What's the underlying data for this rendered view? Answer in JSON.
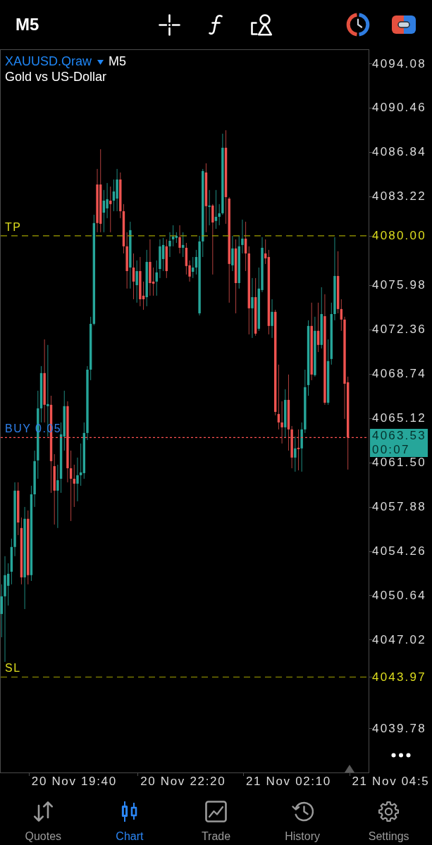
{
  "header": {
    "timeframe": "M5"
  },
  "chart": {
    "symbol": {
      "name": "XAUUSD.Qraw",
      "timeframe": "M5",
      "description": "Gold vs US-Dollar"
    },
    "current_price": {
      "price": "4063.53",
      "countdown": "00:07"
    },
    "chart_data": {
      "type": "candlestick",
      "categories": [
        null,
        null,
        null,
        null,
        null,
        null,
        null,
        null,
        null,
        null,
        null,
        null,
        null,
        null,
        null,
        null,
        null,
        null,
        null,
        null,
        null,
        null,
        "20 Nov 19:40",
        null,
        null,
        null,
        null,
        null,
        null,
        null,
        null,
        null,
        null,
        null,
        null,
        null,
        null,
        null,
        null,
        null,
        null,
        null,
        null,
        null,
        null,
        null,
        null,
        null,
        null,
        null,
        null,
        null,
        null,
        null,
        null,
        "20 Nov 22:20",
        null,
        null,
        null,
        null,
        null,
        null,
        null,
        null,
        null,
        null,
        null,
        null,
        null,
        null,
        null,
        null,
        null,
        null,
        null,
        null,
        null,
        null,
        null,
        null,
        null,
        null,
        null,
        null,
        null,
        null,
        null,
        "21 Nov 02:10",
        null,
        null,
        null,
        null,
        null,
        null,
        null,
        null,
        null,
        null,
        null,
        null,
        null,
        null,
        null,
        null,
        null,
        null,
        null,
        null,
        null,
        null,
        null,
        null,
        null,
        null,
        null,
        null,
        null,
        null,
        "21 Nov 04:5",
        null,
        null,
        null,
        null,
        null,
        null,
        null,
        null,
        null,
        null,
        null,
        null
      ],
      "ohlc": [
        [
          4049.12,
          4051.54,
          4047.22,
          4050.56
        ],
        [
          4050.56,
          4053.84,
          4045.21,
          4052.29
        ],
        [
          4051.42,
          4053.26,
          4049.81,
          4052.4
        ],
        [
          4052.57,
          4055.27,
          4051.54,
          4054.59
        ],
        [
          4054.59,
          4059.87,
          4053.84,
          4059.19
        ],
        [
          4059.19,
          4059.87,
          4055.56,
          4056.59
        ],
        [
          4056.14,
          4057.0,
          4051.54,
          4052.11
        ],
        [
          4052.11,
          4057.86,
          4049.52,
          4056.89
        ],
        [
          4056.89,
          4057.57,
          4051.54,
          4052.29
        ],
        [
          4052.29,
          4059.59,
          4051.82,
          4058.89
        ],
        [
          4058.89,
          4062.46,
          4057.86,
          4061.6
        ],
        [
          4061.66,
          4067.35,
          4060.16,
          4065.91
        ],
        [
          4065.91,
          4069.36,
          4064.76,
          4068.79
        ],
        [
          4068.79,
          4071.54,
          4064.76,
          4066.2
        ],
        [
          4066.09,
          4071.09,
          4063.61,
          4066.26
        ],
        [
          4066.2,
          4066.94,
          4059.01,
          4061.6
        ],
        [
          4061.19,
          4062.17,
          4056.42,
          4059.19
        ],
        [
          4059.19,
          4061.31,
          4056.14,
          4060.04
        ],
        [
          4060.16,
          4064.76,
          4059.01,
          4063.79
        ],
        [
          4063.61,
          4067.35,
          4062.46,
          4066.09
        ],
        [
          4066.09,
          4066.49,
          4059.87,
          4061.02
        ],
        [
          4061.02,
          4062.46,
          4056.71,
          4060.16
        ],
        [
          4060.16,
          4061.31,
          4057.86,
          4059.76
        ],
        [
          4059.76,
          4061.89,
          4058.32,
          4060.45
        ],
        [
          4060.45,
          4063.04,
          4059.59,
          4060.68
        ],
        [
          4060.62,
          4064.76,
          4060.16,
          4063.9
        ],
        [
          4063.9,
          4069.36,
          4063.32,
          4069.07
        ],
        [
          4069.07,
          4073.39,
          4068.21,
          4072.81
        ],
        [
          4072.81,
          4081.72,
          4072.69,
          4081.04
        ],
        [
          4084.19,
          4085.46,
          4080.29,
          4081.04
        ],
        [
          4084.19,
          4087.07,
          4080.29,
          4080.98
        ],
        [
          4081.89,
          4083.74,
          4080.29,
          4082.87
        ],
        [
          4082.24,
          4084.31,
          4081.44,
          4082.99
        ],
        [
          4082.87,
          4084.02,
          4080.29,
          4082.59
        ],
        [
          4082.87,
          4084.6,
          4082.01,
          4083.62
        ],
        [
          4083.04,
          4085.46,
          4082.01,
          4084.6
        ],
        [
          4084.6,
          4085.17,
          4081.44,
          4082.01
        ],
        [
          4082.01,
          4082.59,
          4078.56,
          4079.14
        ],
        [
          4079.14,
          4080.29,
          4075.69,
          4077.12
        ],
        [
          4077.41,
          4081.15,
          4075.69,
          4080.46
        ],
        [
          4077.41,
          4078.56,
          4074.82,
          4076.26
        ],
        [
          4075.97,
          4077.99,
          4074.54,
          4077.12
        ],
        [
          4077.12,
          4078.27,
          4074.25,
          4074.82
        ],
        [
          4075.11,
          4076.26,
          4073.96,
          4074.82
        ],
        [
          4074.99,
          4078.85,
          4074.25,
          4077.87
        ],
        [
          4077.87,
          4079.71,
          4075.11,
          4076.14
        ],
        [
          4076.26,
          4077.41,
          4075.11,
          4076.09
        ],
        [
          4076.26,
          4077.99,
          4075.11,
          4077.01
        ],
        [
          4077.29,
          4079.71,
          4076.55,
          4079.14
        ],
        [
          4078.1,
          4079.83,
          4077.12,
          4079.25
        ],
        [
          4079.14,
          4079.71,
          4076.55,
          4077.12
        ],
        [
          4079.14,
          4080.29,
          4078.27,
          4079.59
        ],
        [
          4079.71,
          4080.86,
          4079.14,
          4079.94
        ],
        [
          4079.83,
          4080.29,
          4079.42,
          4080.0
        ],
        [
          4079.89,
          4080.86,
          4078.56,
          4079.02
        ],
        [
          4079.02,
          4080.29,
          4078.27,
          4079.25
        ],
        [
          4079.02,
          4079.42,
          4076.84,
          4077.53
        ],
        [
          4077.59,
          4077.99,
          4076.26,
          4076.67
        ],
        [
          4077.06,
          4078.27,
          4076.55,
          4077.41
        ],
        [
          4077.41,
          4078.85,
          4076.84,
          4078.27
        ],
        [
          4073.67,
          4080.0,
          4073.5,
          4079.54
        ],
        [
          4079.54,
          4085.46,
          4078.27,
          4085.29
        ],
        [
          4085.17,
          4085.92,
          4080.29,
          4082.42
        ],
        [
          4082.36,
          4083.74,
          4080.86,
          4082.47
        ],
        [
          4082.47,
          4082.59,
          4076.84,
          4081.09
        ],
        [
          4081.21,
          4083.74,
          4080.57,
          4081.55
        ],
        [
          4081.55,
          4082.59,
          4080.86,
          4081.84
        ],
        [
          4081.84,
          4088.34,
          4081.72,
          4087.19
        ],
        [
          4087.19,
          4088.62,
          4080.98,
          4083.16
        ],
        [
          4083.04,
          4083.16,
          4074.54,
          4077.7
        ],
        [
          4077.59,
          4080.0,
          4077.12,
          4078.97
        ],
        [
          4078.97,
          4079.71,
          4073.67,
          4076.14
        ],
        [
          4076.14,
          4080.0,
          4075.69,
          4079.14
        ],
        [
          4079.25,
          4081.32,
          4078.56,
          4079.77
        ],
        [
          4079.77,
          4081.15,
          4077.12,
          4078.56
        ],
        [
          4078.56,
          4079.14,
          4071.95,
          4074.08
        ],
        [
          4074.08,
          4076.55,
          4071.66,
          4074.99
        ],
        [
          4074.99,
          4076.55,
          4071.84,
          4072.01
        ],
        [
          4072.41,
          4077.41,
          4072.24,
          4075.69
        ],
        [
          4075.57,
          4079.89,
          4075.4,
          4079.02
        ],
        [
          4078.56,
          4079.71,
          4077.7,
          4078.16
        ],
        [
          4078.27,
          4078.85,
          4071.95,
          4072.64
        ],
        [
          4072.64,
          4074.82,
          4071.66,
          4073.79
        ],
        [
          4073.79,
          4073.96,
          4065.34,
          4065.62
        ],
        [
          4065.45,
          4069.48,
          4064.19,
          4064.76
        ],
        [
          4064.76,
          4066.49,
          4063.04,
          4064.36
        ],
        [
          4064.36,
          4067.47,
          4063.49,
          4066.6
        ],
        [
          4066.6,
          4068.67,
          4062.46,
          4064.19
        ],
        [
          4064.19,
          4064.47,
          4061.02,
          4061.89
        ],
        [
          4061.89,
          4063.61,
          4060.74,
          4062.64
        ],
        [
          4062.69,
          4064.19,
          4060.85,
          4062.58
        ],
        [
          4062.64,
          4064.76,
          4060.74,
          4064.19
        ],
        [
          4064.19,
          4069.07,
          4063.9,
          4067.64
        ],
        [
          4067.81,
          4073.1,
          4066.94,
          4072.64
        ],
        [
          4072.64,
          4074.54,
          4068.21,
          4068.67
        ],
        [
          4068.62,
          4073.39,
          4068.5,
          4072.24
        ],
        [
          4072.24,
          4074.54,
          4070.51,
          4071.09
        ],
        [
          4071.09,
          4075.8,
          4070.8,
          4073.61
        ],
        [
          4073.44,
          4075.23,
          4066.2,
          4066.37
        ],
        [
          4066.37,
          4071.54,
          4066.2,
          4069.77
        ],
        [
          4069.94,
          4074.54,
          4069.48,
          4073.61
        ],
        [
          4073.61,
          4079.89,
          4073.1,
          4076.72
        ],
        [
          4076.72,
          4078.74,
          4073.67,
          4074.02
        ],
        [
          4074.02,
          4074.82,
          4072.24,
          4073.16
        ],
        [
          4073.16,
          4073.39,
          4065.05,
          4067.92
        ],
        [
          4068.04,
          4068.5,
          4060.91,
          4063.53
        ],
        null,
        null,
        null,
        null,
        null,
        null,
        null,
        null,
        null,
        null,
        null,
        null,
        null,
        null,
        null,
        null,
        null,
        null,
        null,
        null,
        null,
        null,
        null,
        null,
        null
      ],
      "ylim": [
        4036.12,
        4095.23
      ],
      "yticks": [
        {
          "value": 4094.08,
          "label": "4094.08"
        },
        {
          "value": 4090.46,
          "label": "4090.46"
        },
        {
          "value": 4086.84,
          "label": "4086.84"
        },
        {
          "value": 4083.22,
          "label": "4083.22"
        },
        {
          "value": 4080.0,
          "label": "4080.00"
        },
        {
          "value": 4075.98,
          "label": "4075.98"
        },
        {
          "value": 4072.36,
          "label": "4072.36"
        },
        {
          "value": 4068.74,
          "label": "4068.74"
        },
        {
          "value": 4065.12,
          "label": "4065.12"
        },
        {
          "value": 4061.5,
          "label": "4061.50"
        },
        {
          "value": 4057.88,
          "label": "4057.88"
        },
        {
          "value": 4054.26,
          "label": "4054.26"
        },
        {
          "value": 4050.64,
          "label": "4050.64"
        },
        {
          "value": 4047.02,
          "label": "4047.02"
        },
        {
          "value": 4043.97,
          "label": "4043.97"
        },
        {
          "value": 4039.78,
          "label": "4039.78"
        }
      ],
      "ref_lines": [
        {
          "axis": "y",
          "value": 4080.0,
          "label": "TP",
          "color": "#a0a000"
        },
        {
          "axis": "y",
          "value": 4063.53,
          "label": "BUY 0.05",
          "color": "#ff5252"
        },
        {
          "axis": "y",
          "value": 4043.97,
          "label": "SL",
          "color": "#a0a000"
        }
      ]
    }
  },
  "tabs": [
    {
      "label": "Quotes",
      "selected": false
    },
    {
      "label": "Chart",
      "selected": true
    },
    {
      "label": "Trade",
      "selected": false
    },
    {
      "label": "History",
      "selected": false
    },
    {
      "label": "Settings",
      "selected": false
    }
  ]
}
